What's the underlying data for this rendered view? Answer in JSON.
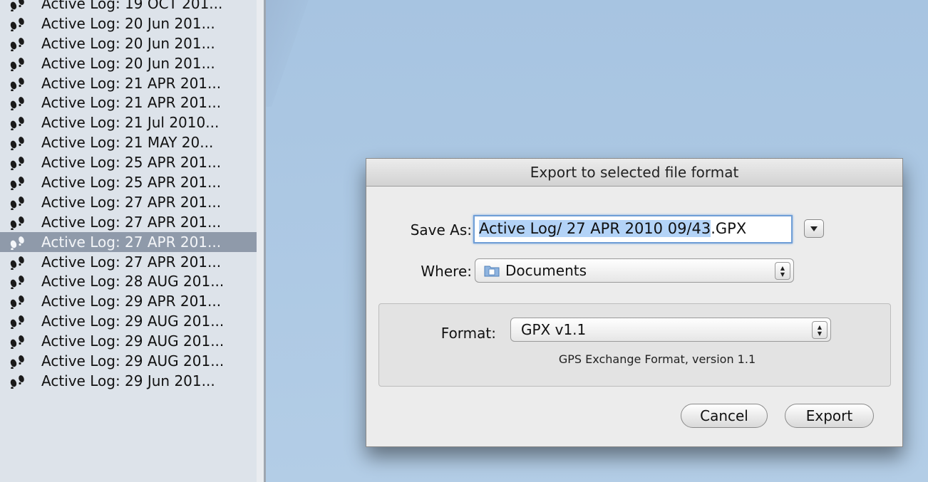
{
  "sidebar": {
    "items": [
      {
        "label": "Active Log: 19 OCT 201...",
        "selected": false
      },
      {
        "label": "Active Log: 20 Jun 201...",
        "selected": false
      },
      {
        "label": "Active Log: 20 Jun 201...",
        "selected": false
      },
      {
        "label": "Active Log: 20 Jun 201...",
        "selected": false
      },
      {
        "label": "Active Log: 21 APR 201...",
        "selected": false
      },
      {
        "label": "Active Log: 21 APR 201...",
        "selected": false
      },
      {
        "label": "Active Log: 21 Jul 2010...",
        "selected": false
      },
      {
        "label": "Active Log: 21 MAY 20...",
        "selected": false
      },
      {
        "label": "Active Log: 25 APR 201...",
        "selected": false
      },
      {
        "label": "Active Log: 25 APR 201...",
        "selected": false
      },
      {
        "label": "Active Log: 27 APR 201...",
        "selected": false
      },
      {
        "label": "Active Log: 27 APR 201...",
        "selected": false
      },
      {
        "label": "Active Log: 27 APR 201...",
        "selected": true
      },
      {
        "label": "Active Log: 27 APR 201...",
        "selected": false
      },
      {
        "label": "Active Log: 28 AUG 201...",
        "selected": false
      },
      {
        "label": "Active Log: 29 APR 201...",
        "selected": false
      },
      {
        "label": "Active Log: 29 AUG 201...",
        "selected": false
      },
      {
        "label": "Active Log: 29 AUG 201...",
        "selected": false
      },
      {
        "label": "Active Log: 29 AUG 201...",
        "selected": false
      },
      {
        "label": "Active Log: 29 Jun 201...",
        "selected": false
      }
    ],
    "item_icon": "track-footprints-icon"
  },
  "dialog": {
    "title": "Export to selected file format",
    "save_as": {
      "label": "Save As:",
      "value_selected": "Active Log/ 27 APR 2010 09/43",
      "value_extension": ".GPX"
    },
    "where": {
      "label": "Where:",
      "value": "Documents",
      "icon": "documents-folder-icon"
    },
    "format": {
      "label": "Format:",
      "value": "GPX v1.1",
      "description": "GPS Exchange Format, version 1.1"
    },
    "buttons": {
      "cancel": "Cancel",
      "export": "Export"
    }
  },
  "colors": {
    "selection": "#8f9aaa",
    "desktop": "#aac6e2",
    "text_selection": "#b3d3f7"
  }
}
